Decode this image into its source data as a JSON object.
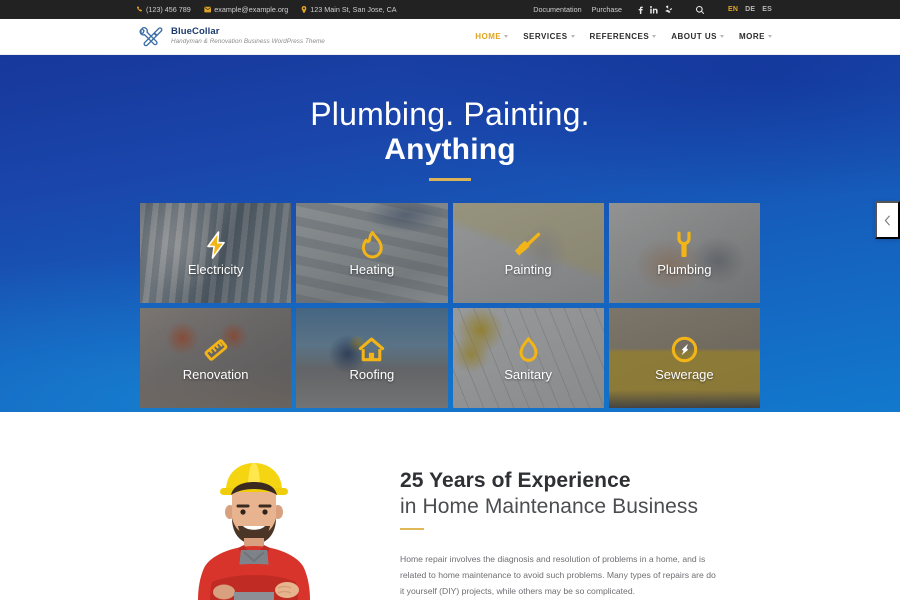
{
  "topbar": {
    "phone": "(123) 456 789",
    "email": "example@example.org",
    "address": "123 Main St, San Jose, CA",
    "documentation": "Documentation",
    "purchase": "Purchase",
    "socials": [
      "facebook-icon",
      "linkedin-icon",
      "yelp-icon"
    ],
    "search": "search-icon",
    "languages": [
      {
        "code": "EN",
        "active": true
      },
      {
        "code": "DE",
        "active": false
      },
      {
        "code": "ES",
        "active": false
      }
    ],
    "accent_color": "#e0a526",
    "background_color": "#222222"
  },
  "header": {
    "brand_name": "BlueCollar",
    "brand_tagline": "Handyman & Renovation Business WordPress Theme",
    "logo_icon": "wrench-hammer-icon",
    "nav": [
      {
        "label": "HOME",
        "active": true,
        "has_dropdown": true
      },
      {
        "label": "SERVICES",
        "active": false,
        "has_dropdown": true
      },
      {
        "label": "REFERENCES",
        "active": false,
        "has_dropdown": true
      },
      {
        "label": "ABOUT US",
        "active": false,
        "has_dropdown": true
      },
      {
        "label": "MORE",
        "active": false,
        "has_dropdown": true
      }
    ]
  },
  "hero": {
    "line1": "Plumbing. Painting.",
    "line2": "Anything",
    "gradient_from": "#17379b",
    "gradient_to": "#1279cd",
    "divider_color": "#d9b356",
    "slider_prev_icon": "chevron-left-icon"
  },
  "services": [
    {
      "label": "Electricity",
      "icon": "lightning-bolt-icon",
      "photo": "ph-electricity"
    },
    {
      "label": "Heating",
      "icon": "flame-icon",
      "photo": "ph-heating"
    },
    {
      "label": "Painting",
      "icon": "paint-brush-icon",
      "photo": "ph-painting"
    },
    {
      "label": "Plumbing",
      "icon": "wrench-icon",
      "photo": "ph-plumbing"
    },
    {
      "label": "Renovation",
      "icon": "ruler-icon",
      "photo": "ph-renovation"
    },
    {
      "label": "Roofing",
      "icon": "house-icon",
      "photo": "ph-roofing"
    },
    {
      "label": "Sanitary",
      "icon": "water-drop-icon",
      "photo": "ph-sanitary"
    },
    {
      "label": "Sewerage",
      "icon": "sewer-nozzle-icon",
      "photo": "ph-sewerage"
    }
  ],
  "experience": {
    "heading_bold": "25 Years of Experience",
    "heading_light": "in Home Maintenance Business",
    "divider_color": "#e0b858",
    "paragraph": "Home repair involves the diagnosis and resolution of problems in a home, and is related to home maintenance to avoid such problems. Many types of repairs are do it yourself (DIY) projects, while others may be so complicated.",
    "image": "smiling-worker-yellow-hardhat-red-shirt"
  }
}
